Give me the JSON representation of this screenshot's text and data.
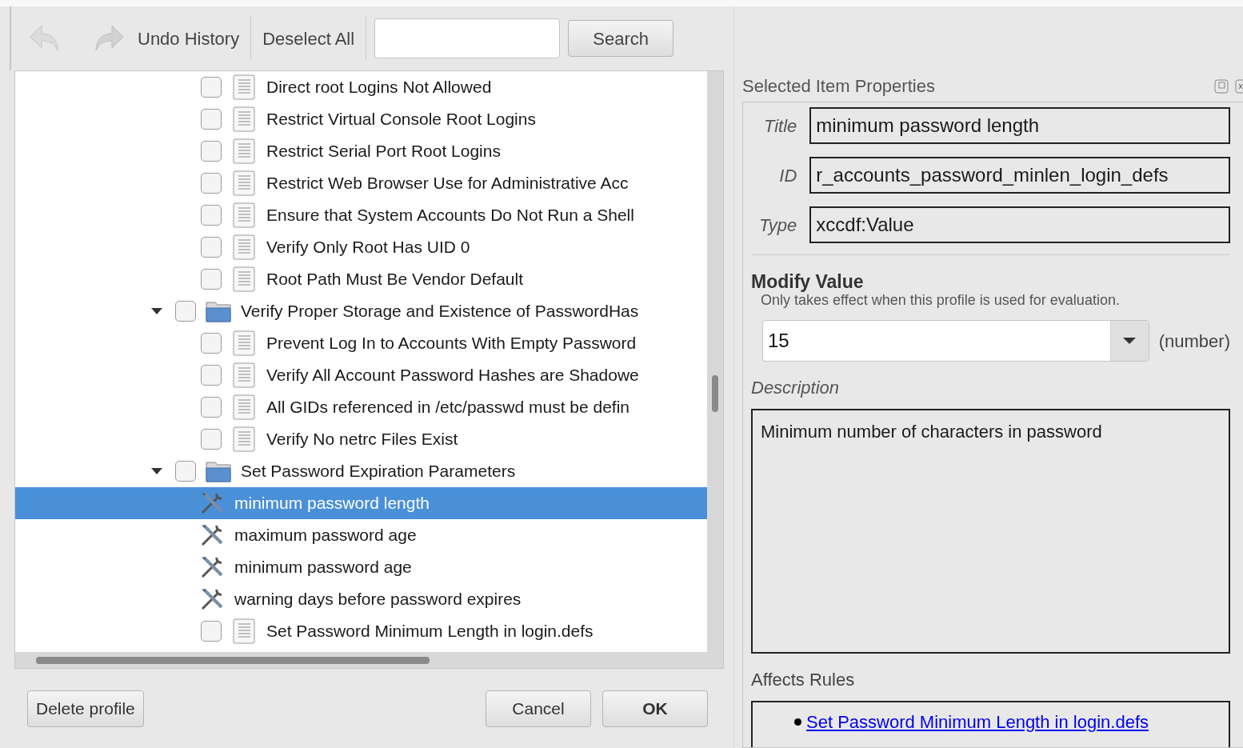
{
  "toolbar": {
    "undo_history": "Undo History",
    "deselect_all": "Deselect All",
    "search_button": "Search"
  },
  "tree": {
    "items": [
      {
        "kind": "rule",
        "title": "Direct root Logins Not Allowed",
        "checked": false,
        "selected": false
      },
      {
        "kind": "rule",
        "title": "Restrict Virtual Console Root Logins",
        "checked": false,
        "selected": false
      },
      {
        "kind": "rule",
        "title": "Restrict Serial Port Root Logins",
        "checked": false,
        "selected": false
      },
      {
        "kind": "rule",
        "title": "Restrict Web Browser Use for Administrative Acc",
        "checked": false,
        "selected": false
      },
      {
        "kind": "rule",
        "title": "Ensure that System Accounts Do Not Run a Shell",
        "checked": false,
        "selected": false
      },
      {
        "kind": "rule",
        "title": "Verify Only Root Has UID 0",
        "checked": false,
        "selected": false
      },
      {
        "kind": "rule",
        "title": "Root Path Must Be Vendor Default",
        "checked": false,
        "selected": false
      },
      {
        "kind": "group",
        "title": "Verify Proper Storage and Existence of PasswordHas",
        "checked": false,
        "selected": false,
        "expanded": true,
        "children": [
          {
            "kind": "rule",
            "title": "Prevent Log In to Accounts With Empty Password",
            "checked": false,
            "selected": false
          },
          {
            "kind": "rule",
            "title": "Verify All Account Password Hashes are Shadowe",
            "checked": false,
            "selected": false
          },
          {
            "kind": "rule",
            "title": "All GIDs referenced in /etc/passwd must be defin",
            "checked": false,
            "selected": false
          },
          {
            "kind": "rule",
            "title": "Verify No netrc Files Exist",
            "checked": false,
            "selected": false
          }
        ]
      },
      {
        "kind": "group",
        "title": "Set Password Expiration Parameters",
        "checked": false,
        "selected": false,
        "expanded": true,
        "children": [
          {
            "kind": "value",
            "title": "minimum password length",
            "selected": true
          },
          {
            "kind": "value",
            "title": "maximum password age",
            "selected": false
          },
          {
            "kind": "value",
            "title": "minimum password age",
            "selected": false
          },
          {
            "kind": "value",
            "title": "warning days before password expires",
            "selected": false
          },
          {
            "kind": "rule",
            "title": "Set Password Minimum Length in login.defs",
            "checked": false,
            "selected": false
          }
        ]
      }
    ]
  },
  "buttons": {
    "delete": "Delete profile",
    "cancel": "Cancel",
    "ok": "OK"
  },
  "properties": {
    "header": "Selected Item Properties",
    "fields": [
      {
        "label": "Title",
        "value": "minimum password length"
      },
      {
        "label": "ID",
        "value": "r_accounts_password_minlen_login_defs"
      },
      {
        "label": "Type",
        "value": "xccdf:Value"
      }
    ],
    "modify_title": "Modify Value",
    "modify_note": "Only takes effect when this profile is used for evaluation.",
    "value": "15",
    "value_type": "(number)",
    "description_label": "Description",
    "description": "Minimum number of characters in password",
    "affects_label": "Affects Rules",
    "affects": [
      "Set Password Minimum Length in login.defs"
    ]
  }
}
